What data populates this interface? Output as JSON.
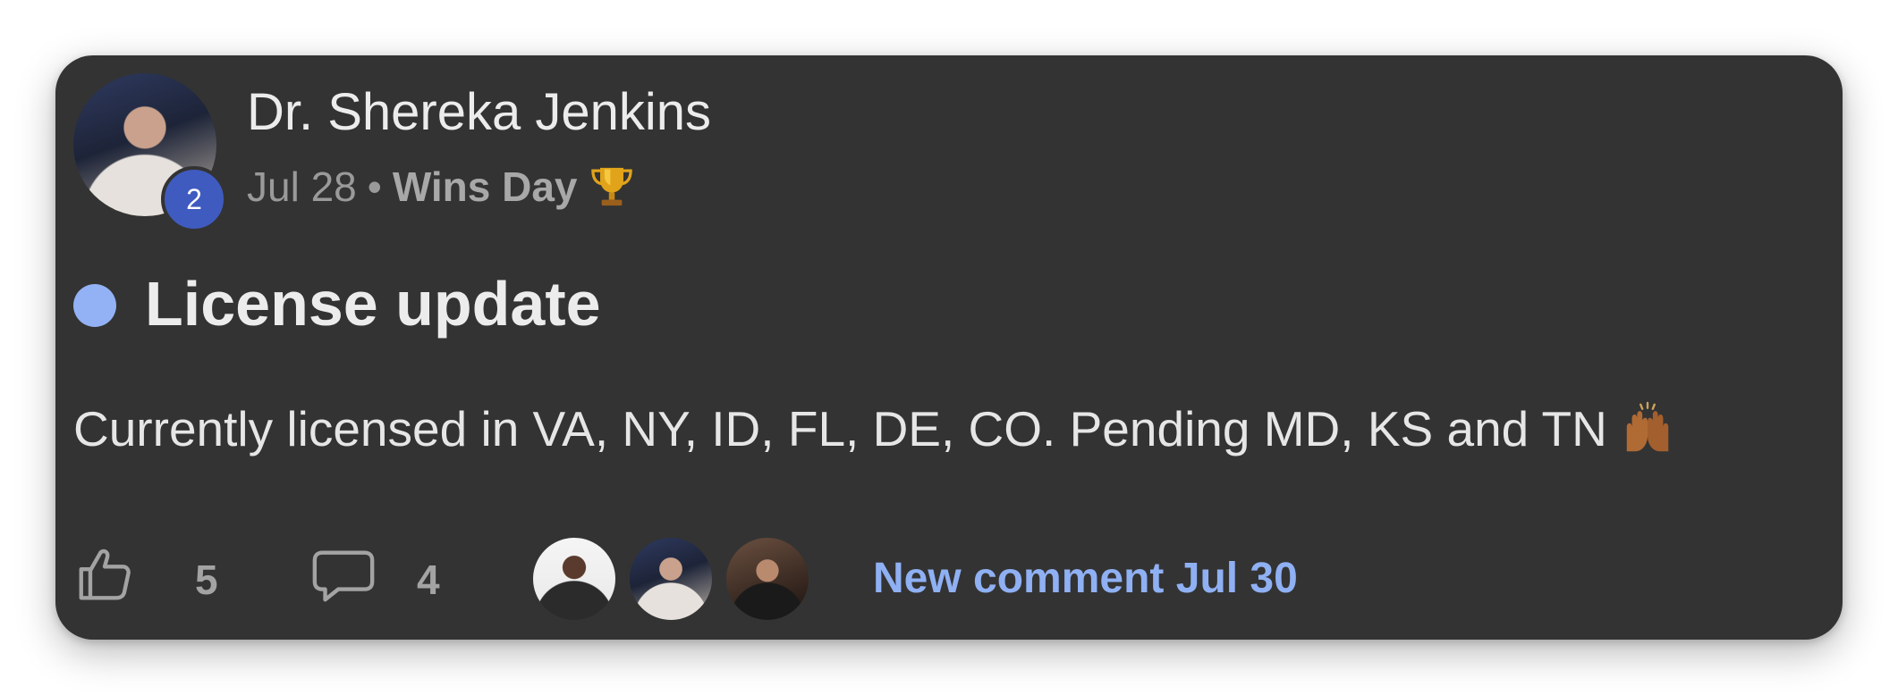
{
  "post": {
    "author": {
      "name": "Dr. Shereka Jenkins",
      "level": "2",
      "avatar_icon": "user-avatar"
    },
    "meta": {
      "date": "Jul 28",
      "separator": "•",
      "category": "Wins Day",
      "category_icon": "trophy-icon"
    },
    "unread": true,
    "title": "License update",
    "body": "Currently licensed in VA, NY, ID, FL, DE, CO. Pending MD, KS and TN",
    "body_icon": "raised-hands-icon",
    "footer": {
      "likes": "5",
      "comments": "4",
      "commenter_avatars": [
        "commenter-avatar-1",
        "commenter-avatar-2",
        "commenter-avatar-3"
      ],
      "latest_comment": "New comment Jul 30"
    }
  },
  "colors": {
    "card_background": "#333333",
    "level_badge": "#3f5bc0",
    "unread_dot": "#93b2f5",
    "link_accent": "#8fb0f3"
  }
}
